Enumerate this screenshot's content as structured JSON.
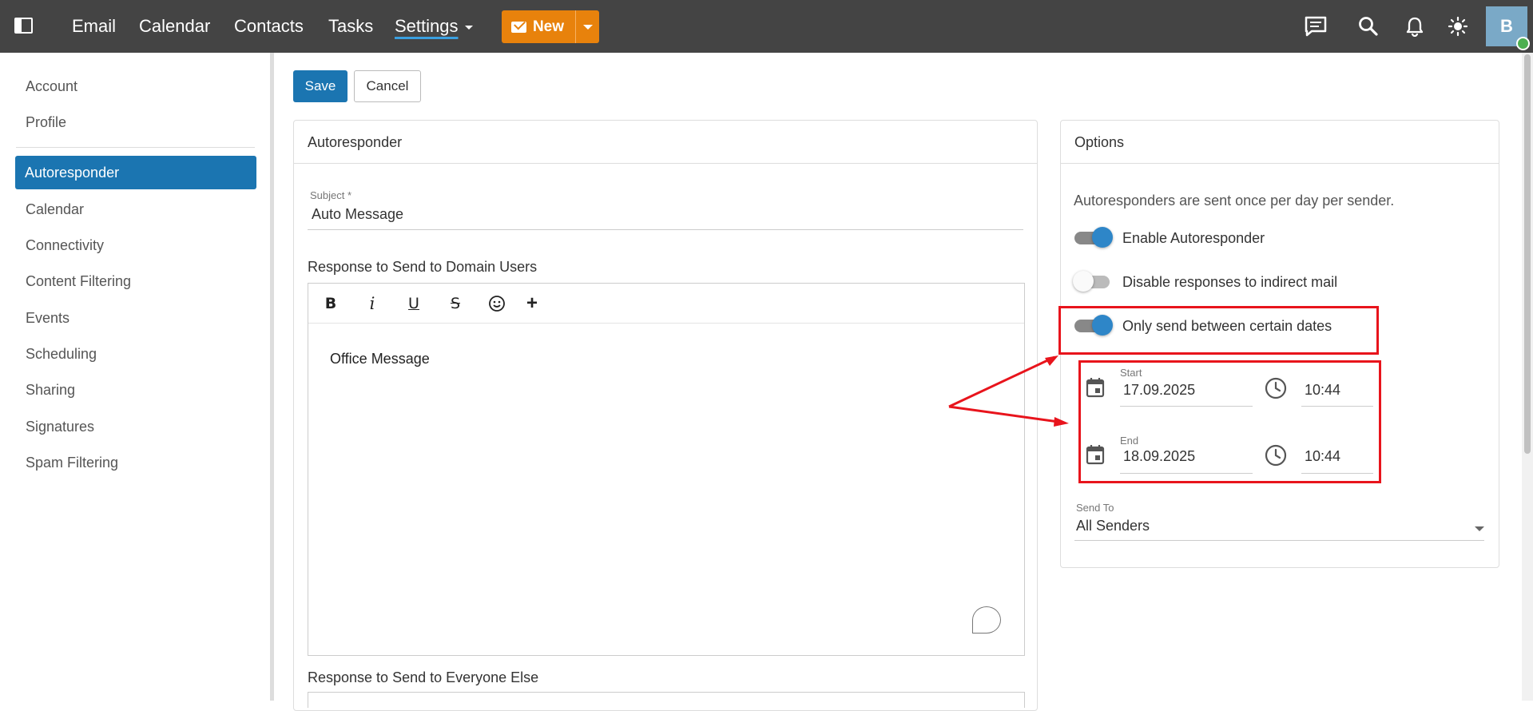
{
  "topnav": {
    "items": [
      "Email",
      "Calendar",
      "Contacts",
      "Tasks",
      "Settings"
    ],
    "new_label": "New",
    "avatar_initial": "B",
    "icons": [
      "sidebar-toggle-icon",
      "chat-icon",
      "search-icon",
      "bell-icon",
      "brightness-icon"
    ],
    "colors": {
      "bar": "#444444",
      "new_button": "#e8820c",
      "accent": "#1b75b1"
    }
  },
  "sidebar": {
    "items": [
      "Account",
      "Profile",
      "Autoresponder",
      "Calendar",
      "Connectivity",
      "Content Filtering",
      "Events",
      "Scheduling",
      "Sharing",
      "Signatures",
      "Spam Filtering"
    ],
    "active": "Autoresponder"
  },
  "actions": {
    "save": "Save",
    "cancel": "Cancel"
  },
  "autoresponder": {
    "title": "Autoresponder",
    "subject_label": "Subject *",
    "subject_value": "Auto Message",
    "domain_response_label": "Response to Send to Domain Users",
    "domain_response_body": "Office Message",
    "everyone_response_label": "Response to Send to Everyone Else",
    "toolbar": [
      "B",
      "i",
      "U",
      "S",
      "emoji",
      "+"
    ]
  },
  "options": {
    "title": "Options",
    "info": "Autoresponders are sent once per day per sender.",
    "toggles": [
      {
        "label": "Enable Autoresponder",
        "on": true
      },
      {
        "label": "Disable responses to indirect mail",
        "on": false
      },
      {
        "label": "Only send between certain dates",
        "on": true
      }
    ],
    "start_label": "Start",
    "start_date": "17.09.2025",
    "start_time": "10:44",
    "end_label": "End",
    "end_date": "18.09.2025",
    "end_time": "10:44",
    "send_to_label": "Send To",
    "send_to_value": "All Senders"
  },
  "annotation_color": "#e8141c"
}
